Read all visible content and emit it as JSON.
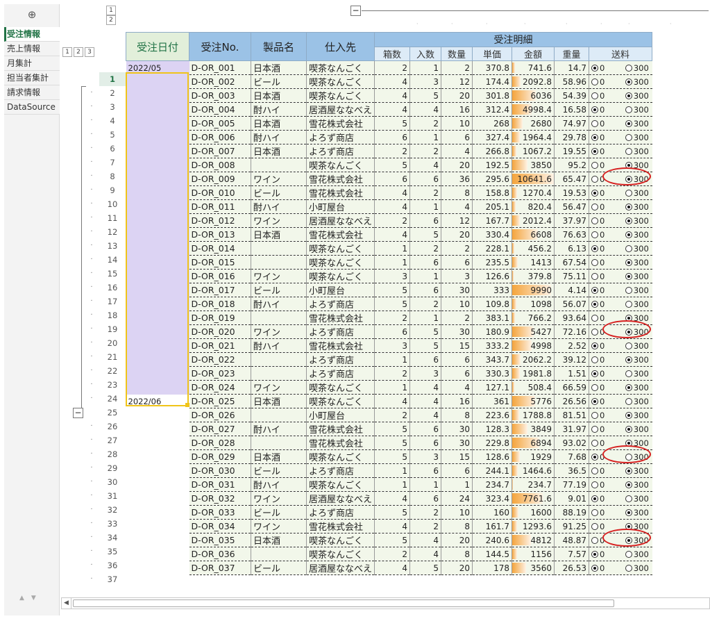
{
  "sheets": {
    "add_icon": "⊕",
    "tabs": [
      "受注情報",
      "売上情報",
      "月集計",
      "担当者集計",
      "請求情報",
      "DataSource"
    ],
    "active_index": 0
  },
  "outline": {
    "row_levels": [
      "1",
      "2",
      "3"
    ],
    "col_levels": [
      "1",
      "2"
    ],
    "collapse_symbol": "−"
  },
  "headers": {
    "date": "受注日付",
    "order_no": "受注No.",
    "product": "製品名",
    "supplier": "仕入先",
    "group": "受注明細",
    "sub": [
      "箱数",
      "入数",
      "数量",
      "単価",
      "金額",
      "重量",
      "送料"
    ]
  },
  "colors": {
    "header_blue": "#9bc2e6",
    "subheader_blue": "#ddebf7",
    "date_fill": "#dcd3f3",
    "cell_fill": "#f2f7ea",
    "bar_orange": "#f4a43c",
    "oval_red": "#d62020",
    "selection_yellow": "#f0c419"
  },
  "shipping_options": [
    "0",
    "300"
  ],
  "amount_max": 10641.6,
  "selected_row": "1",
  "rows": [
    {
      "n": "1",
      "date": "2022/05",
      "no": "D-OR_001",
      "prod": "日本酒",
      "sup": "喫茶なんごく",
      "box": "2",
      "per": "1",
      "qty": "2",
      "price": "370.8",
      "amt": "741.6",
      "wt": "14.7",
      "ship": "0"
    },
    {
      "n": "2",
      "date": "",
      "no": "D-OR_002",
      "prod": "ビール",
      "sup": "喫茶なんごく",
      "box": "4",
      "per": "3",
      "qty": "12",
      "price": "174.4",
      "amt": "2092.8",
      "wt": "58.96",
      "ship": "300"
    },
    {
      "n": "3",
      "date": "",
      "no": "D-OR_003",
      "prod": "日本酒",
      "sup": "喫茶なんごく",
      "box": "4",
      "per": "5",
      "qty": "20",
      "price": "301.8",
      "amt": "6036",
      "wt": "54.39",
      "ship": "300"
    },
    {
      "n": "4",
      "date": "",
      "no": "D-OR_004",
      "prod": "酎ハイ",
      "sup": "居酒屋ななべえ",
      "box": "4",
      "per": "4",
      "qty": "16",
      "price": "312.4",
      "amt": "4998.4",
      "wt": "16.58",
      "ship": "0"
    },
    {
      "n": "5",
      "date": "",
      "no": "D-OR_005",
      "prod": "日本酒",
      "sup": "雪花株式会社",
      "box": "5",
      "per": "2",
      "qty": "10",
      "price": "268",
      "amt": "2680",
      "wt": "74.97",
      "ship": "300"
    },
    {
      "n": "6",
      "date": "",
      "no": "D-OR_006",
      "prod": "酎ハイ",
      "sup": "よろず商店",
      "box": "6",
      "per": "1",
      "qty": "6",
      "price": "327.4",
      "amt": "1964.4",
      "wt": "29.78",
      "ship": "0"
    },
    {
      "n": "7",
      "date": "",
      "no": "D-OR_007",
      "prod": "日本酒",
      "sup": "よろず商店",
      "box": "2",
      "per": "2",
      "qty": "4",
      "price": "266.8",
      "amt": "1067.2",
      "wt": "19.55",
      "ship": "0"
    },
    {
      "n": "8",
      "date": "",
      "no": "D-OR_008",
      "prod": "",
      "sup": "喫茶なんごく",
      "box": "5",
      "per": "4",
      "qty": "20",
      "price": "192.5",
      "amt": "3850",
      "wt": "95.2",
      "ship": "300"
    },
    {
      "n": "9",
      "date": "",
      "no": "D-OR_009",
      "prod": "ワイン",
      "sup": "雪花株式会社",
      "box": "6",
      "per": "6",
      "qty": "36",
      "price": "295.6",
      "amt": "10641.6",
      "wt": "65.47",
      "ship": "300"
    },
    {
      "n": "10",
      "date": "",
      "no": "D-OR_010",
      "prod": "ビール",
      "sup": "雪花株式会社",
      "box": "4",
      "per": "2",
      "qty": "8",
      "price": "158.8",
      "amt": "1270.4",
      "wt": "19.53",
      "ship": "0"
    },
    {
      "n": "11",
      "date": "",
      "no": "D-OR_011",
      "prod": "酎ハイ",
      "sup": "小町屋台",
      "box": "4",
      "per": "1",
      "qty": "4",
      "price": "205.1",
      "amt": "820.4",
      "wt": "56.47",
      "ship": "300"
    },
    {
      "n": "12",
      "date": "",
      "no": "D-OR_012",
      "prod": "ワイン",
      "sup": "居酒屋ななべえ",
      "box": "2",
      "per": "6",
      "qty": "12",
      "price": "167.7",
      "amt": "2012.4",
      "wt": "37.97",
      "ship": "300"
    },
    {
      "n": "13",
      "date": "",
      "no": "D-OR_013",
      "prod": "日本酒",
      "sup": "雪花株式会社",
      "box": "4",
      "per": "5",
      "qty": "20",
      "price": "330.4",
      "amt": "6608",
      "wt": "76.63",
      "ship": "300"
    },
    {
      "n": "14",
      "date": "",
      "no": "D-OR_014",
      "prod": "",
      "sup": "喫茶なんごく",
      "box": "1",
      "per": "2",
      "qty": "2",
      "price": "228.1",
      "amt": "456.2",
      "wt": "6.13",
      "ship": "0"
    },
    {
      "n": "15",
      "date": "",
      "no": "D-OR_015",
      "prod": "",
      "sup": "喫茶なんごく",
      "box": "1",
      "per": "6",
      "qty": "6",
      "price": "235.5",
      "amt": "1413",
      "wt": "67.54",
      "ship": "300"
    },
    {
      "n": "16",
      "date": "",
      "no": "D-OR_016",
      "prod": "ワイン",
      "sup": "喫茶なんごく",
      "box": "3",
      "per": "1",
      "qty": "3",
      "price": "126.6",
      "amt": "379.8",
      "wt": "75.11",
      "ship": "300"
    },
    {
      "n": "17",
      "date": "",
      "no": "D-OR_017",
      "prod": "ビール",
      "sup": "小町屋台",
      "box": "5",
      "per": "6",
      "qty": "30",
      "price": "333",
      "amt": "9990",
      "wt": "4.14",
      "ship": "0"
    },
    {
      "n": "18",
      "date": "",
      "no": "D-OR_018",
      "prod": "酎ハイ",
      "sup": "よろず商店",
      "box": "5",
      "per": "2",
      "qty": "10",
      "price": "109.8",
      "amt": "1098",
      "wt": "56.07",
      "ship": "0"
    },
    {
      "n": "19",
      "date": "",
      "no": "D-OR_019",
      "prod": "",
      "sup": "雪花株式会社",
      "box": "2",
      "per": "1",
      "qty": "2",
      "price": "383.1",
      "amt": "766.2",
      "wt": "93.64",
      "ship": "300"
    },
    {
      "n": "20",
      "date": "",
      "no": "D-OR_020",
      "prod": "ワイン",
      "sup": "よろず商店",
      "box": "6",
      "per": "5",
      "qty": "30",
      "price": "180.9",
      "amt": "5427",
      "wt": "72.16",
      "ship": "300"
    },
    {
      "n": "21",
      "date": "",
      "no": "D-OR_021",
      "prod": "酎ハイ",
      "sup": "雪花株式会社",
      "box": "3",
      "per": "5",
      "qty": "15",
      "price": "333.2",
      "amt": "4998",
      "wt": "2.52",
      "ship": "0"
    },
    {
      "n": "22",
      "date": "",
      "no": "D-OR_022",
      "prod": "",
      "sup": "よろず商店",
      "box": "1",
      "per": "6",
      "qty": "6",
      "price": "343.7",
      "amt": "2062.2",
      "wt": "39.12",
      "ship": "300"
    },
    {
      "n": "23",
      "date": "",
      "no": "D-OR_023",
      "prod": "",
      "sup": "よろず商店",
      "box": "2",
      "per": "3",
      "qty": "6",
      "price": "330.3",
      "amt": "1981.8",
      "wt": "1.51",
      "ship": "0"
    },
    {
      "n": "24",
      "date": "",
      "no": "D-OR_024",
      "prod": "ワイン",
      "sup": "喫茶なんごく",
      "box": "1",
      "per": "4",
      "qty": "4",
      "price": "127.1",
      "amt": "508.4",
      "wt": "66.59",
      "ship": "300"
    },
    {
      "n": "25",
      "date": "2022/06",
      "no": "D-OR_025",
      "prod": "日本酒",
      "sup": "喫茶なんごく",
      "box": "4",
      "per": "4",
      "qty": "16",
      "price": "361",
      "amt": "5776",
      "wt": "26.56",
      "ship": "0"
    },
    {
      "n": "26",
      "date": "",
      "no": "D-OR_026",
      "prod": "",
      "sup": "小町屋台",
      "box": "2",
      "per": "4",
      "qty": "8",
      "price": "223.6",
      "amt": "1788.8",
      "wt": "81.51",
      "ship": "300"
    },
    {
      "n": "27",
      "date": "",
      "no": "D-OR_027",
      "prod": "酎ハイ",
      "sup": "雪花株式会社",
      "box": "5",
      "per": "6",
      "qty": "30",
      "price": "128.3",
      "amt": "3849",
      "wt": "31.97",
      "ship": "300"
    },
    {
      "n": "28",
      "date": "",
      "no": "D-OR_028",
      "prod": "",
      "sup": "雪花株式会社",
      "box": "5",
      "per": "6",
      "qty": "30",
      "price": "229.8",
      "amt": "6894",
      "wt": "93.02",
      "ship": "300"
    },
    {
      "n": "29",
      "date": "",
      "no": "D-OR_029",
      "prod": "日本酒",
      "sup": "喫茶なんごく",
      "box": "5",
      "per": "3",
      "qty": "15",
      "price": "128.6",
      "amt": "1929",
      "wt": "7.68",
      "ship": "0"
    },
    {
      "n": "30",
      "date": "",
      "no": "D-OR_030",
      "prod": "ビール",
      "sup": "よろず商店",
      "box": "1",
      "per": "6",
      "qty": "6",
      "price": "244.1",
      "amt": "1464.6",
      "wt": "36.5",
      "ship": "300"
    },
    {
      "n": "31",
      "date": "",
      "no": "D-OR_031",
      "prod": "酎ハイ",
      "sup": "喫茶なんごく",
      "box": "1",
      "per": "1",
      "qty": "1",
      "price": "234.7",
      "amt": "234.7",
      "wt": "77.19",
      "ship": "300"
    },
    {
      "n": "32",
      "date": "",
      "no": "D-OR_032",
      "prod": "ワイン",
      "sup": "居酒屋ななべえ",
      "box": "4",
      "per": "6",
      "qty": "24",
      "price": "323.4",
      "amt": "7761.6",
      "wt": "9.01",
      "ship": "0"
    },
    {
      "n": "33",
      "date": "",
      "no": "D-OR_033",
      "prod": "ビール",
      "sup": "よろず商店",
      "box": "5",
      "per": "2",
      "qty": "10",
      "price": "160",
      "amt": "1600",
      "wt": "88.19",
      "ship": "300"
    },
    {
      "n": "34",
      "date": "",
      "no": "D-OR_034",
      "prod": "ワイン",
      "sup": "雪花株式会社",
      "box": "4",
      "per": "2",
      "qty": "8",
      "price": "161.7",
      "amt": "1293.6",
      "wt": "91.25",
      "ship": "300"
    },
    {
      "n": "35",
      "date": "",
      "no": "D-OR_035",
      "prod": "日本酒",
      "sup": "喫茶なんごく",
      "box": "5",
      "per": "4",
      "qty": "20",
      "price": "240.6",
      "amt": "4812",
      "wt": "48.87",
      "ship": "300"
    },
    {
      "n": "36",
      "date": "",
      "no": "D-OR_036",
      "prod": "",
      "sup": "喫茶なんごく",
      "box": "2",
      "per": "4",
      "qty": "8",
      "price": "144.5",
      "amt": "1156",
      "wt": "7.57",
      "ship": "0"
    },
    {
      "n": "37",
      "date": "",
      "no": "D-OR_037",
      "prod": "ビール",
      "sup": "居酒屋ななべえ",
      "box": "4",
      "per": "5",
      "qty": "20",
      "price": "178",
      "amt": "3560",
      "wt": "26.53",
      "ship": "0"
    }
  ],
  "highlighted_weights_rows": [
    "8",
    "19",
    "28",
    "34"
  ]
}
